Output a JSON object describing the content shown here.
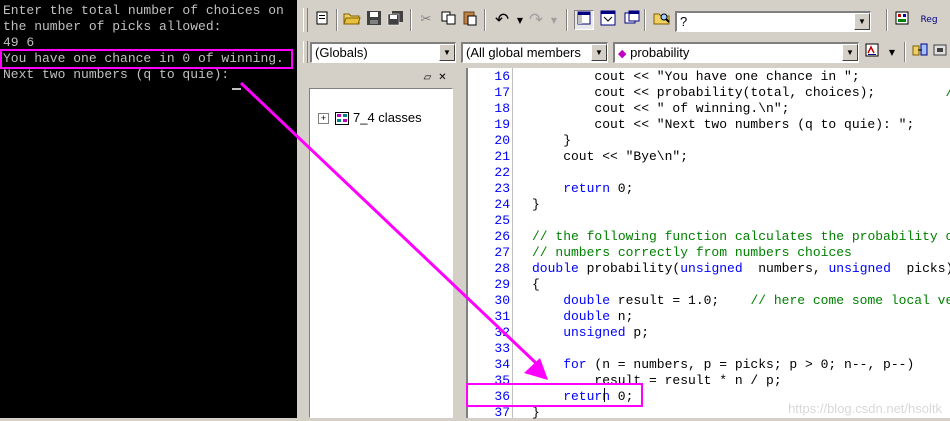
{
  "console": {
    "lines": [
      "Enter the total number of choices on",
      "the number of picks allowed:",
      "49 6",
      "You have one chance in 0 of winning.",
      "Next two numbers (q to quie):"
    ]
  },
  "toolbar": {
    "find_value": "?",
    "reg_label": "Reg"
  },
  "nav": {
    "scope": "(Globals)",
    "members": "(All global members",
    "function": "probability"
  },
  "workspace": {
    "tree_item": "7_4 classes"
  },
  "editor": {
    "lines": [
      {
        "n": "16",
        "indent": 4,
        "parts": [
          {
            "t": "cout << \"You have one chance in \";",
            "c": ""
          }
        ]
      },
      {
        "n": "17",
        "indent": 4,
        "parts": [
          {
            "t": "cout << probability(total, choices);         ",
            "c": ""
          },
          {
            "t": "//",
            "c": "cm"
          }
        ]
      },
      {
        "n": "18",
        "indent": 4,
        "parts": [
          {
            "t": "cout << \" of winning.\\n\";",
            "c": ""
          }
        ]
      },
      {
        "n": "19",
        "indent": 4,
        "parts": [
          {
            "t": "cout << \"Next two numbers (q to quie): \";",
            "c": ""
          }
        ]
      },
      {
        "n": "20",
        "indent": 2,
        "parts": [
          {
            "t": "}",
            "c": ""
          }
        ]
      },
      {
        "n": "21",
        "indent": 2,
        "parts": [
          {
            "t": "cout << \"Bye\\n\";",
            "c": ""
          }
        ]
      },
      {
        "n": "22",
        "indent": 0,
        "parts": []
      },
      {
        "n": "23",
        "indent": 2,
        "parts": [
          {
            "t": "return",
            "c": "kw"
          },
          {
            "t": " 0;",
            "c": ""
          }
        ]
      },
      {
        "n": "24",
        "indent": 0,
        "parts": [
          {
            "t": "}",
            "c": ""
          }
        ]
      },
      {
        "n": "25",
        "indent": 0,
        "parts": []
      },
      {
        "n": "26",
        "indent": 0,
        "parts": [
          {
            "t": "// the following function calculates the probability of",
            "c": "cm"
          }
        ]
      },
      {
        "n": "27",
        "indent": 0,
        "parts": [
          {
            "t": "// numbers correctly from numbers choices",
            "c": "cm"
          }
        ]
      },
      {
        "n": "28",
        "indent": 0,
        "parts": [
          {
            "t": "double",
            "c": "kw"
          },
          {
            "t": " probability(",
            "c": ""
          },
          {
            "t": "unsigned",
            "c": "kw"
          },
          {
            "t": "  numbers, ",
            "c": ""
          },
          {
            "t": "unsigned",
            "c": "kw"
          },
          {
            "t": "  picks)",
            "c": ""
          }
        ]
      },
      {
        "n": "29",
        "indent": 0,
        "parts": [
          {
            "t": "{",
            "c": ""
          }
        ]
      },
      {
        "n": "30",
        "indent": 2,
        "parts": [
          {
            "t": "double",
            "c": "kw"
          },
          {
            "t": " result = 1.0;    ",
            "c": ""
          },
          {
            "t": "// here come some local ver",
            "c": "cm"
          }
        ]
      },
      {
        "n": "31",
        "indent": 2,
        "parts": [
          {
            "t": "double",
            "c": "kw"
          },
          {
            "t": " n;",
            "c": ""
          }
        ]
      },
      {
        "n": "32",
        "indent": 2,
        "parts": [
          {
            "t": "unsigned",
            "c": "kw"
          },
          {
            "t": " p;",
            "c": ""
          }
        ]
      },
      {
        "n": "33",
        "indent": 0,
        "parts": []
      },
      {
        "n": "34",
        "indent": 2,
        "parts": [
          {
            "t": "for",
            "c": "kw"
          },
          {
            "t": " (n = numbers, p = picks; p > 0; n--, p--)",
            "c": ""
          }
        ]
      },
      {
        "n": "35",
        "indent": 4,
        "parts": [
          {
            "t": "result = result * n / p;",
            "c": ""
          }
        ]
      },
      {
        "n": "36",
        "indent": 2,
        "parts": [
          {
            "t": "return",
            "c": "kw"
          },
          {
            "t": " 0;",
            "c": ""
          }
        ]
      },
      {
        "n": "37",
        "indent": 0,
        "parts": [
          {
            "t": "}",
            "c": ""
          }
        ]
      }
    ]
  },
  "watermark": "https://blog.csdn.net/hsoltk",
  "colors": {
    "highlight": "#ff00ff",
    "keyword": "#0000ff",
    "comment": "#008000",
    "line_number": "#0000ff"
  }
}
